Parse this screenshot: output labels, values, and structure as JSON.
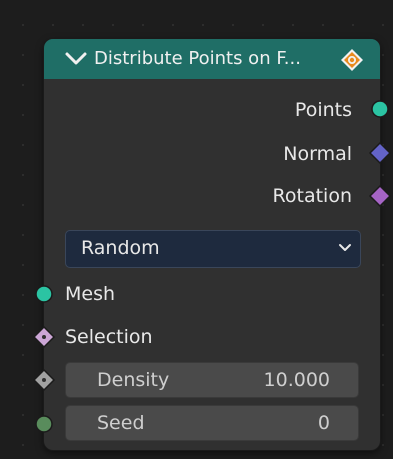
{
  "node": {
    "title": "Distribute Points on F...",
    "header_color": "#1f6e66",
    "outputs": [
      {
        "label": "Points",
        "socket": "geometry",
        "color": "#2bc4a3"
      },
      {
        "label": "Normal",
        "socket": "vector",
        "color": "#6363c7"
      },
      {
        "label": "Rotation",
        "socket": "rotation",
        "color": "#a564c5"
      }
    ],
    "mode_dropdown": {
      "value": "Random"
    },
    "inputs": [
      {
        "label": "Mesh",
        "socket": "geometry",
        "color": "#2bc4a3"
      },
      {
        "label": "Selection",
        "socket": "boolean",
        "color": "#cca6d6"
      },
      {
        "label": "Density",
        "value": "10.000",
        "socket": "float",
        "color": "#a1a1a1"
      },
      {
        "label": "Seed",
        "value": "0",
        "socket": "integer",
        "color": "#598c5c"
      }
    ],
    "icons": {
      "collapse": "chevron-down-icon",
      "header_right": "node-gizmo-icon",
      "dropdown": "chevron-down-icon"
    }
  }
}
